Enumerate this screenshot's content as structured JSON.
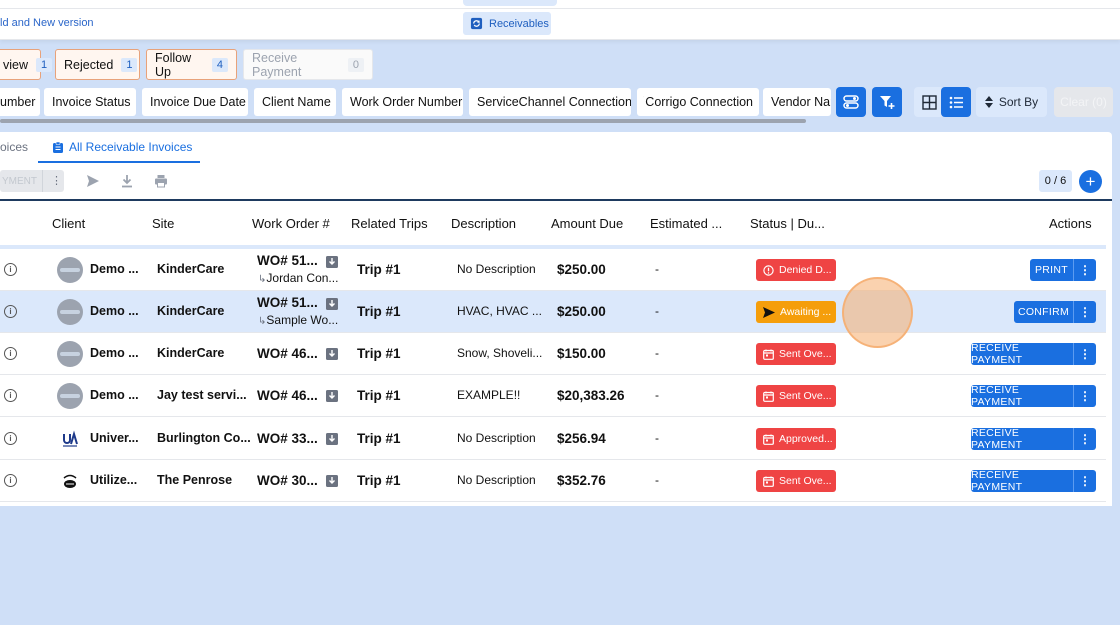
{
  "topbar": {
    "link_text": "ld and New version",
    "active_tab": "Receivables"
  },
  "pills": [
    {
      "label": "view",
      "count": "1"
    },
    {
      "label": "Rejected",
      "count": "1"
    },
    {
      "label": "Follow Up",
      "count": "4"
    },
    {
      "label": "Receive Payment",
      "count": "0"
    }
  ],
  "columns_chips": [
    "umber",
    "Invoice Status",
    "Invoice Due Date",
    "Client Name",
    "Work Order Number",
    "ServiceChannel Connection",
    "Corrigo Connection",
    "Vendor Nar"
  ],
  "toolbar": {
    "sort_label": "Sort By",
    "clear_label": "Clear (0)"
  },
  "subtabs": {
    "left": "oices",
    "active": "All Receivable Invoices"
  },
  "bulk": {
    "label": "YMENT",
    "dots": "⋮"
  },
  "counter": "0 / 6",
  "plus": "+",
  "headers": {
    "client": "Client",
    "site": "Site",
    "work_order": "Work Order #",
    "trips": "Related Trips",
    "description": "Description",
    "amount": "Amount Due",
    "estimated": "Estimated ...",
    "status": "Status | Du...",
    "actions": "Actions"
  },
  "rows": [
    {
      "client": "Demo ...",
      "site": "KinderCare",
      "wo": "WO# 51...",
      "wo_sub": "Jordan Con...",
      "trip": "Trip #1",
      "desc": "No Description",
      "amount": "$250.00",
      "est": "-",
      "status": "Denied D...",
      "status_color": "#ef4444",
      "action": "PRINT"
    },
    {
      "client": "Demo ...",
      "site": "KinderCare",
      "wo": "WO# 51...",
      "wo_sub": "Sample Wo...",
      "trip": "Trip #1",
      "desc": "HVAC, HVAC ...",
      "amount": "$250.00",
      "est": "-",
      "status": "Awaiting ...",
      "status_color": "#f59e0b",
      "action": "CONFIRM"
    },
    {
      "client": "Demo ...",
      "site": "KinderCare",
      "wo": "WO# 46...",
      "wo_sub": "",
      "trip": "Trip #1",
      "desc": "Snow, Shoveli...",
      "amount": "$150.00",
      "est": "-",
      "status": "Sent Ove...",
      "status_color": "#ef4444",
      "action": "RECEIVE PAYMENT"
    },
    {
      "client": "Demo ...",
      "site": "Jay test servi...",
      "wo": "WO# 46...",
      "wo_sub": "",
      "trip": "Trip #1",
      "desc": "EXAMPLE!!",
      "amount": "$20,383.26",
      "est": "-",
      "status": "Sent Ove...",
      "status_color": "#ef4444",
      "action": "RECEIVE PAYMENT"
    },
    {
      "client": "Univer...",
      "site": "Burlington Co...",
      "wo": "WO# 33...",
      "wo_sub": "",
      "trip": "Trip #1",
      "desc": "No Description",
      "amount": "$256.94",
      "est": "-",
      "status": "Approved...",
      "status_color": "#ef4444",
      "action": "RECEIVE PAYMENT"
    },
    {
      "client": "Utilize...",
      "site": "The Penrose",
      "wo": "WO# 30...",
      "wo_sub": "",
      "trip": "Trip #1",
      "desc": "No Description",
      "amount": "$352.76",
      "est": "-",
      "status": "Sent Ove...",
      "status_color": "#ef4444",
      "action": "RECEIVE PAYMENT"
    }
  ]
}
